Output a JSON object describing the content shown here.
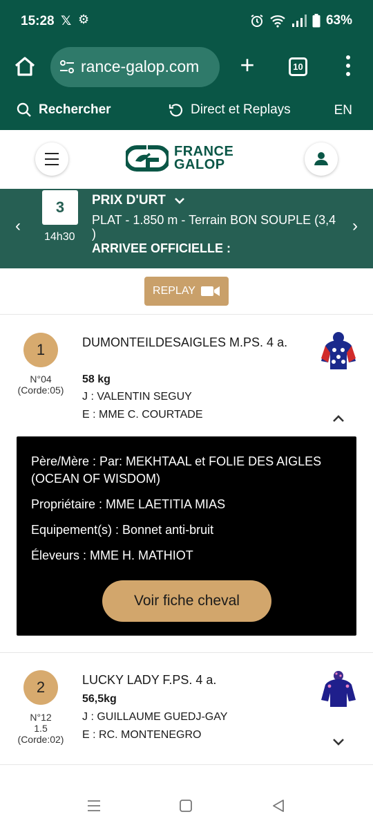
{
  "status_bar": {
    "time": "15:28",
    "battery": "63%",
    "icons": [
      "x-icon",
      "gear-icon",
      "alarm-icon",
      "wifi-icon",
      "signal-icon",
      "battery-icon"
    ]
  },
  "browser": {
    "url": "rance-galop.com",
    "tab_count": "10",
    "icons": [
      "home-icon",
      "tune-icon",
      "plus-icon",
      "tabs-icon",
      "more-vert-icon"
    ]
  },
  "site_nav": {
    "search_label": "Rechercher",
    "direct_label": "Direct et Replays",
    "lang_label": "EN"
  },
  "logo": {
    "line1": "FRANCE",
    "line2": "GALOP"
  },
  "race": {
    "number": "3",
    "time": "14h30",
    "name": "PRIX D'URT",
    "description": "PLAT - 1.850 m - Terrain BON SOUPLE (3,4 )",
    "status": "ARRIVEE OFFICIELLE :"
  },
  "replay_label": "REPLAY",
  "horses": [
    {
      "rank": "1",
      "number": "N°04",
      "odds": "",
      "corde": "(Corde:05)",
      "name": "DUMONTEILDESAIGLES M.PS. 4 a.",
      "weight": "58 kg",
      "jockey": "J : VALENTIN SEGUY",
      "trainer": "E : MME C. COURTADE",
      "expanded": true
    },
    {
      "rank": "2",
      "number": "N°12",
      "odds": "1.5",
      "corde": "(Corde:02)",
      "name": "LUCKY LADY F.PS. 4 a.",
      "weight": "56,5kg",
      "jockey": "J : GUILLAUME GUEDJ-GAY",
      "trainer": "E : RC. MONTENEGRO",
      "expanded": false
    }
  ],
  "details": {
    "parents": "Père/Mère : Par: MEKHTAAL et FOLIE DES AIGLES (OCEAN OF WISDOM)",
    "owner": "Propriétaire : MME LAETITIA MIAS",
    "equipment": "Equipement(s) : Bonnet anti-bruit",
    "breeders": "Éleveurs : MME H. MATHIOT",
    "cta_label": "Voir fiche cheval"
  },
  "colors": {
    "header_green": "#0a5646",
    "banner_green": "#265f53",
    "gold": "#c9a06a"
  }
}
